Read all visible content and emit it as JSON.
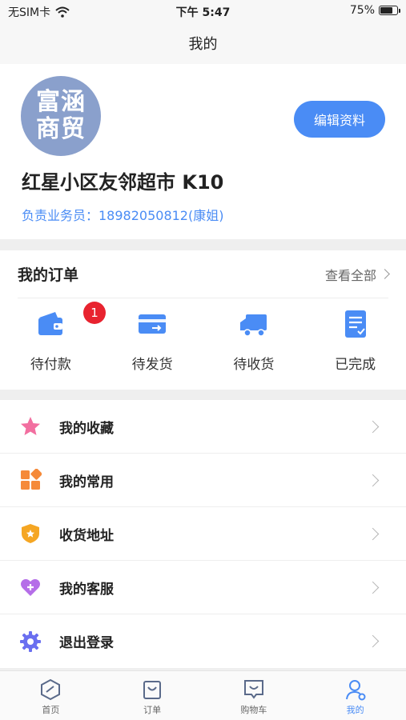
{
  "status_bar": {
    "carrier": "无SIM卡",
    "time": "下午 5:47",
    "battery": "75%",
    "battery_level": 0.75
  },
  "nav": {
    "title": "我的"
  },
  "profile": {
    "avatar_line1": "富涵",
    "avatar_line2": "商贸",
    "edit_label": "编辑资料",
    "store_name": "红星小区友邻超市 K10",
    "salesman": "负责业务员：18982050812(康姐)"
  },
  "orders": {
    "title": "我的订单",
    "view_all": "查看全部",
    "items": [
      {
        "label": "待付款",
        "badge": "1",
        "icon": "wallet-icon"
      },
      {
        "label": "待发货",
        "icon": "card-icon"
      },
      {
        "label": "待收货",
        "icon": "truck-icon"
      },
      {
        "label": "已完成",
        "icon": "document-check-icon"
      }
    ]
  },
  "menu": {
    "items": [
      {
        "label": "我的收藏",
        "icon": "star-icon",
        "color": "#f26fa0"
      },
      {
        "label": "我的常用",
        "icon": "grid-icon",
        "color": "#f58a3a"
      },
      {
        "label": "收货地址",
        "icon": "shield-icon",
        "color": "#f5a623"
      },
      {
        "label": "我的客服",
        "icon": "heart-icon",
        "color": "#b56ee8"
      },
      {
        "label": "退出登录",
        "icon": "gear-icon",
        "color": "#6a6ff0"
      }
    ]
  },
  "tabbar": {
    "items": [
      {
        "label": "首页",
        "icon": "home-icon"
      },
      {
        "label": "订单",
        "icon": "order-bag-icon"
      },
      {
        "label": "购物车",
        "icon": "cart-chat-icon"
      },
      {
        "label": "我的",
        "icon": "user-icon",
        "active": true
      }
    ]
  },
  "colors": {
    "accent": "#4a8cf5",
    "badge": "#e8232f",
    "avatar_bg": "#8aa0cc"
  }
}
